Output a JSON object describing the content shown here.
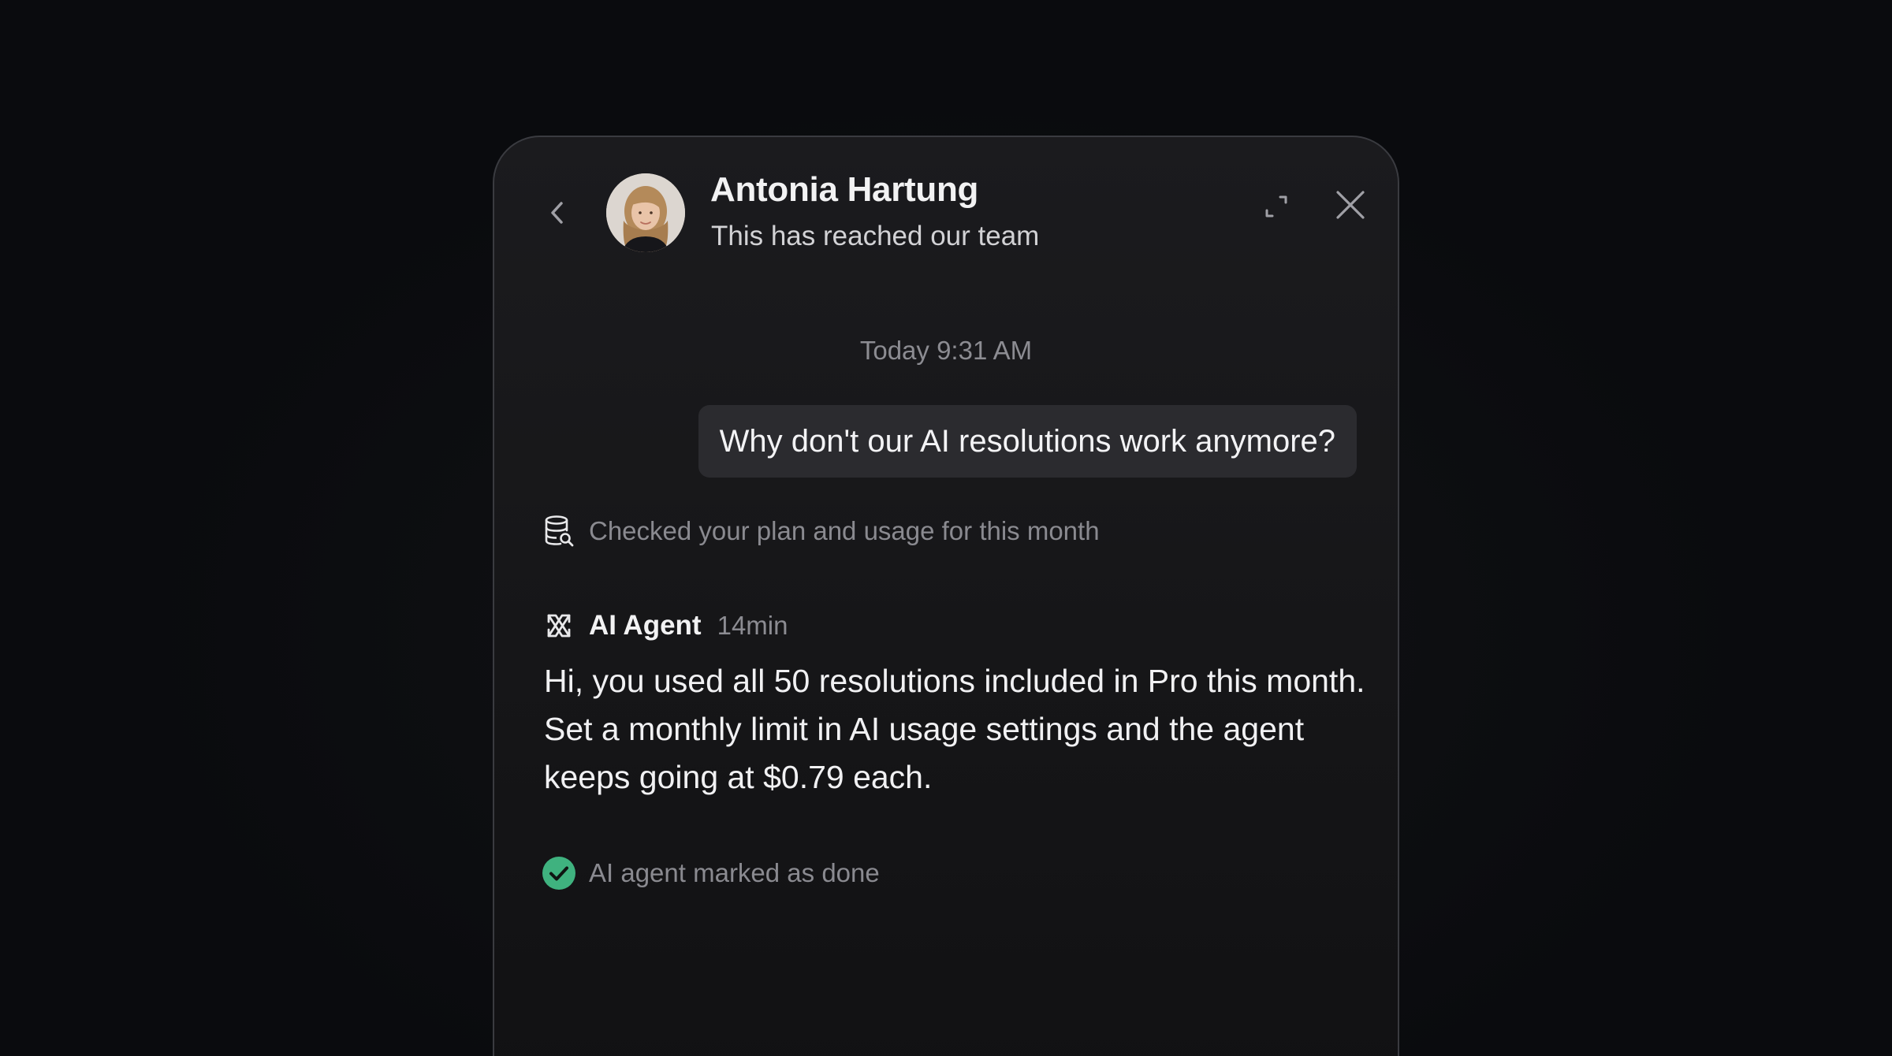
{
  "header": {
    "contact_name": "Antonia Hartung",
    "contact_status": "This has reached our team",
    "back_icon": "chevron-left-icon",
    "expand_icon": "expand-icon",
    "close_icon": "close-icon"
  },
  "conversation": {
    "timestamp": "Today 9:31 AM",
    "user_message": "Why don't our AI resolutions work anymore?",
    "usage_event": {
      "icon": "database-search-icon",
      "text": "Checked your plan and usage for this month"
    },
    "agent_reply": {
      "icon": "ai-agent-icon",
      "author": "AI Agent",
      "time": "14min",
      "text": "Hi, you used all 50 resolutions included in Pro this month. Set a monthly limit in AI usage settings and the agent keeps going at $0.79 each."
    },
    "done_event": {
      "icon": "check-circle-icon",
      "text": "AI agent marked as done",
      "color": "#3fb27f"
    }
  },
  "colors": {
    "background": "#0a0b0e",
    "panel": "#1b1b1e",
    "bubble": "#2b2b2f",
    "success": "#3fb27f"
  }
}
